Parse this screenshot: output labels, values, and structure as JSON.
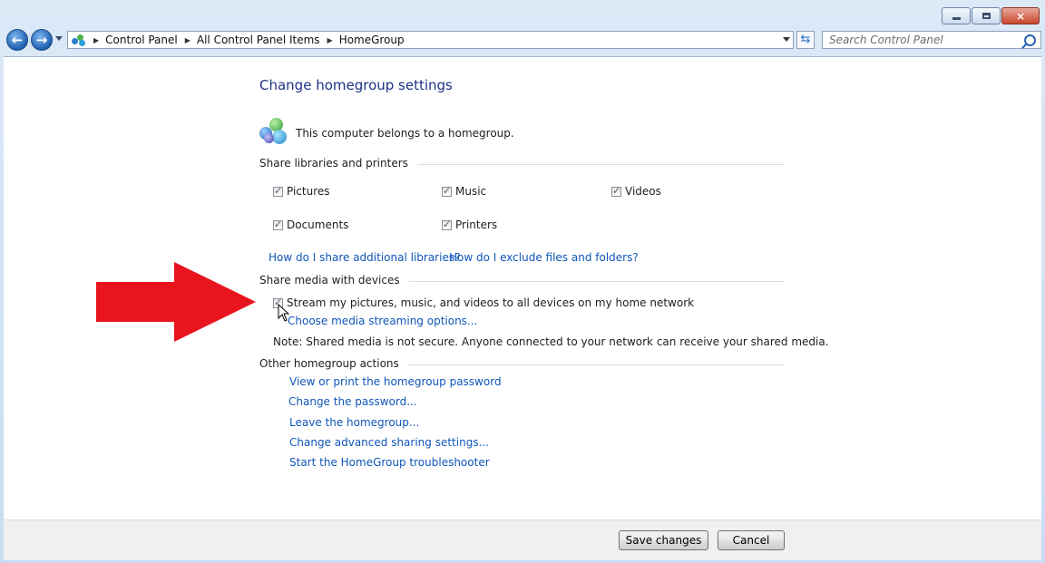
{
  "window": {
    "controls": {
      "minimize": "minimize",
      "maximize": "maximize",
      "close": "×"
    }
  },
  "nav": {
    "breadcrumb": [
      "Control Panel",
      "All Control Panel Items",
      "HomeGroup"
    ],
    "search_placeholder": "Search Control Panel"
  },
  "page": {
    "title": "Change homegroup settings",
    "belongs_text": "This computer belongs to a homegroup.",
    "share_section": "Share libraries and printers",
    "libraries": [
      {
        "label": "Pictures",
        "checked": true
      },
      {
        "label": "Music",
        "checked": true
      },
      {
        "label": "Videos",
        "checked": true
      },
      {
        "label": "Documents",
        "checked": true
      },
      {
        "label": "Printers",
        "checked": true
      }
    ],
    "help_links": [
      "How do I share additional libraries?",
      "How do I exclude files and folders?"
    ],
    "media_section": "Share media with devices",
    "stream_label": "Stream my pictures, music, and videos to all devices on my home network",
    "stream_checked": true,
    "streaming_options_link": "Choose media streaming options...",
    "note": "Note: Shared media is not secure. Anyone connected to your network can receive your shared media.",
    "other_section": "Other homegroup actions",
    "actions": [
      "View or print the homegroup password",
      "Change the password...",
      "Leave the homegroup...",
      "Change advanced sharing settings...",
      "Start the HomeGroup troubleshooter"
    ]
  },
  "footer": {
    "save": "Save changes",
    "cancel": "Cancel"
  },
  "colors": {
    "link": "#0f56b9",
    "title": "#1e3287",
    "arrow": "#e8151f"
  }
}
